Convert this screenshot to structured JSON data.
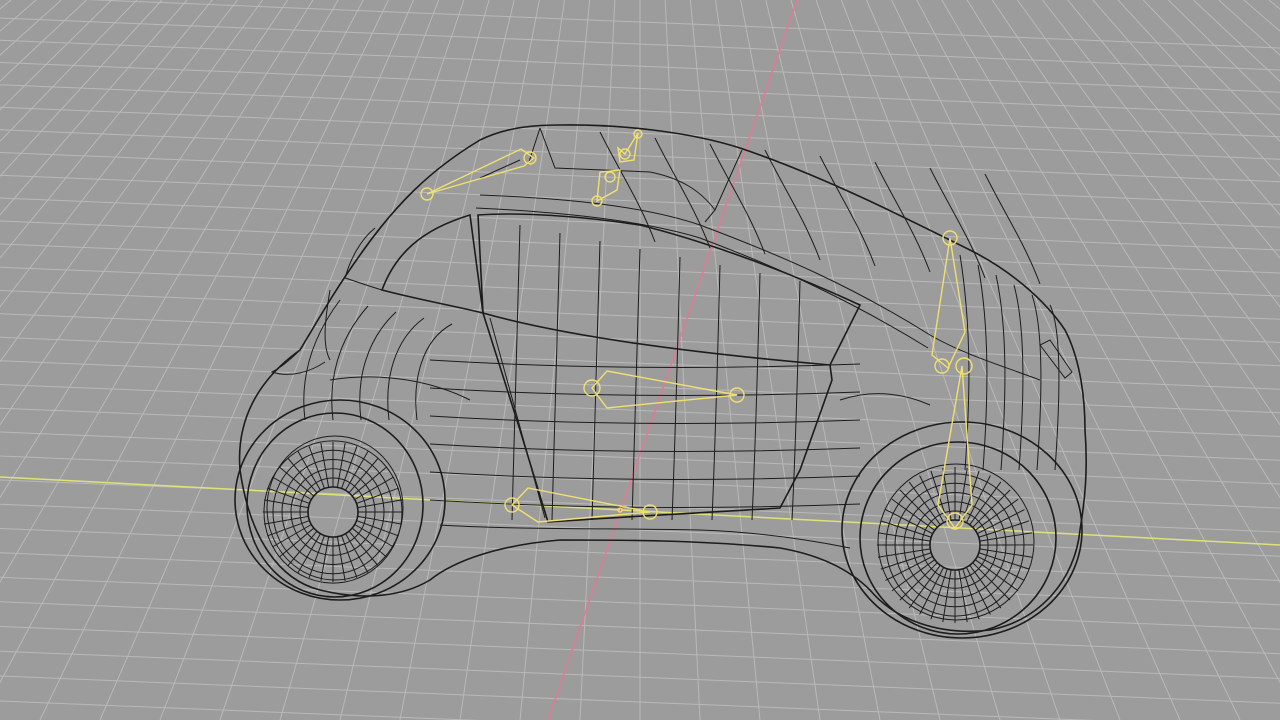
{
  "viewport": {
    "background_color": "#9c9c9c",
    "grid_color": "#b9b9b9",
    "x_axis_color": "#e1e17a",
    "y_axis_color": "#e07a92",
    "mesh_color": "#1c1c1c",
    "bone_color": "#f0e070"
  },
  "scene": {
    "object": "car-body-wireframe",
    "bones": [
      {
        "name": "roof-left-bone"
      },
      {
        "name": "roof-mid-bone-a"
      },
      {
        "name": "roof-mid-bone-b"
      },
      {
        "name": "pillar-rear-bone"
      },
      {
        "name": "rear-wheel-bone"
      },
      {
        "name": "door-mid-bone"
      },
      {
        "name": "sill-bone"
      }
    ]
  }
}
